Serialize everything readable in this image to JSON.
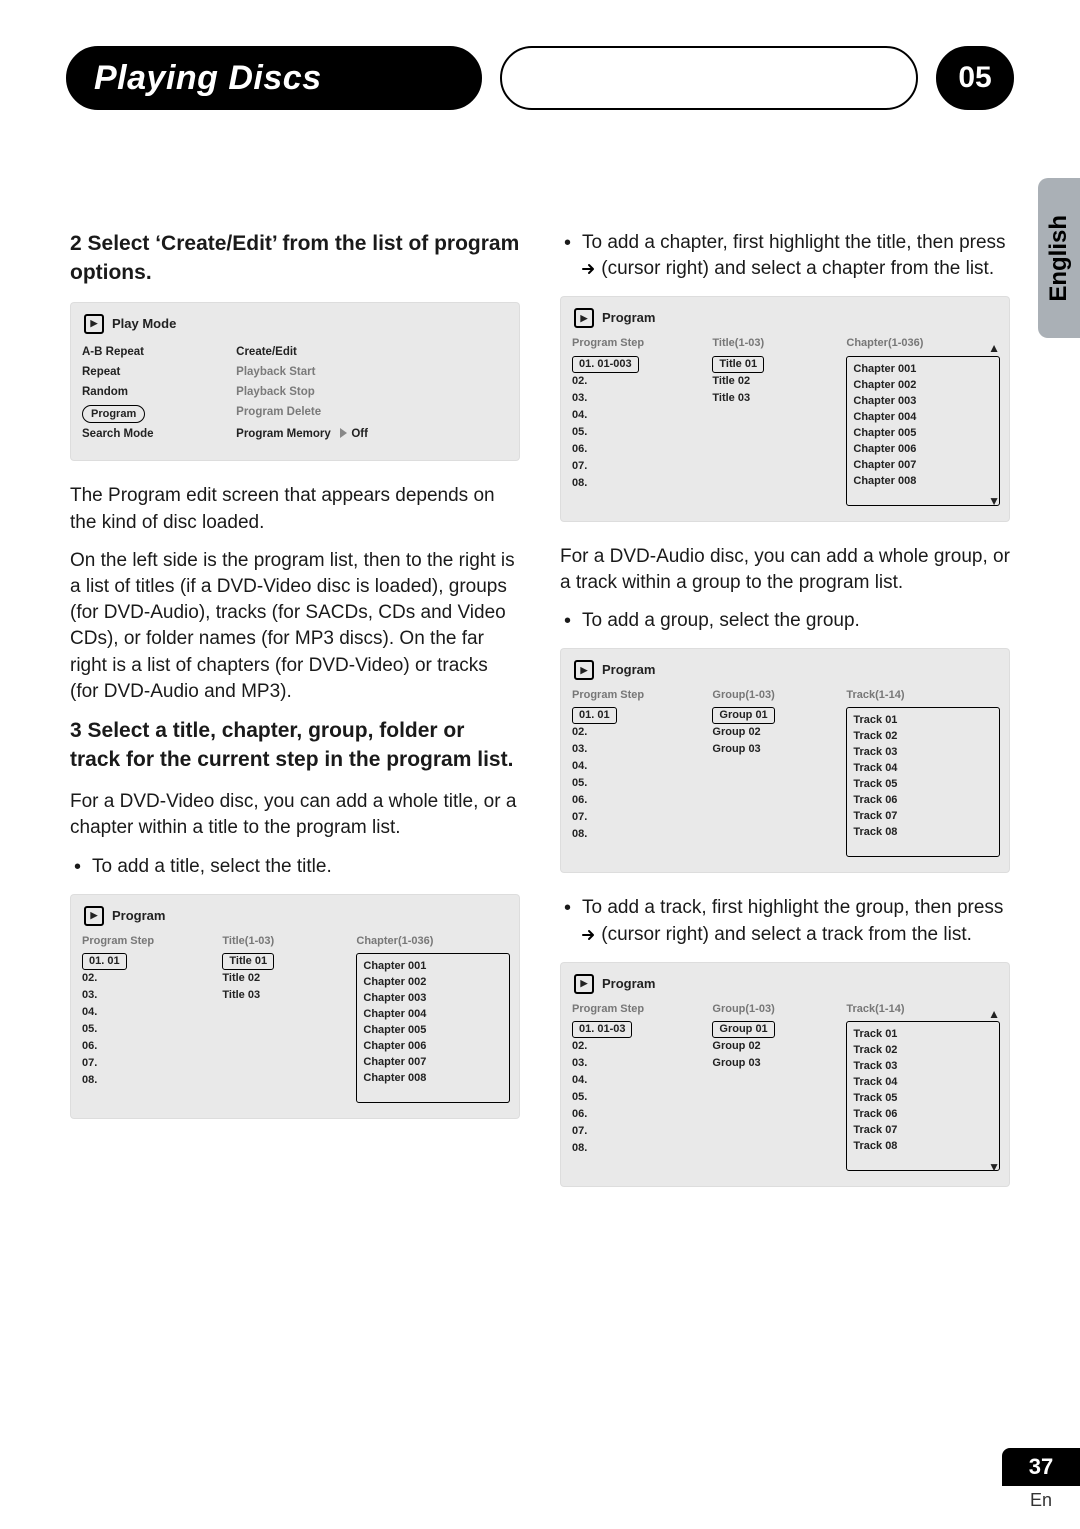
{
  "section": {
    "title": "Playing Discs",
    "number": "05"
  },
  "lang_tab": "English",
  "page_number": "37",
  "page_lang": "En",
  "left": {
    "step2": "2   Select ‘Create/Edit’ from the list of program options.",
    "p1": "The Program edit screen that appears depends on the kind of disc loaded.",
    "p2": "On the left side is the program list, then to the right is a list of titles (if a DVD-Video disc is loaded), groups (for DVD-Audio), tracks (for SACDs, CDs and Video CDs), or folder names (for MP3 discs). On the far right is a list of chapters (for DVD-Video) or tracks (for DVD-Audio and MP3).",
    "step3": "3   Select a title, chapter, group, folder or track for the current step in the program list.",
    "p3": "For a DVD-Video disc, you can add a whole title, or a chapter within a title to the program list.",
    "bullet1": "To add a title, select the title."
  },
  "right": {
    "bullet1a": "To add a chapter, first highlight the title, then press ",
    "bullet1b": " (cursor right) and select a chapter from the list.",
    "p1": "For a DVD-Audio disc, you can add a whole group, or a track within a group to the program list.",
    "bullet2": "To add a group, select the group.",
    "bullet3a": "To add a track, first highlight the group, then press ",
    "bullet3b": " (cursor right) and select a track from the list."
  },
  "osd_playmode": {
    "title": "Play Mode",
    "left_menu": [
      "A-B Repeat",
      "Repeat",
      "Random",
      "Program",
      "Search Mode"
    ],
    "selected_left": "Program",
    "right_opts": [
      {
        "label": "Create/Edit",
        "state": "active"
      },
      {
        "label": "Playback Start",
        "state": "disabled"
      },
      {
        "label": "Playback Stop",
        "state": "disabled"
      },
      {
        "label": "Program Delete",
        "state": "disabled"
      },
      {
        "label": "Program Memory",
        "state": "toggle",
        "value": "Off"
      }
    ]
  },
  "osd_prog_title": {
    "title": "Program",
    "col1": "Program Step",
    "col2": "Title(1-03)",
    "col3": "Chapter(1-036)",
    "steps": [
      "01. 01",
      "02.",
      "03.",
      "04.",
      "05.",
      "06.",
      "07.",
      "08."
    ],
    "titles": [
      "Title 01",
      "Title 02",
      "Title 03"
    ],
    "chapters": [
      "Chapter 001",
      "Chapter 002",
      "Chapter 003",
      "Chapter 004",
      "Chapter 005",
      "Chapter 006",
      "Chapter 007",
      "Chapter 008"
    ],
    "boxed_step": "01. 01",
    "boxed_title": "Title 01"
  },
  "osd_prog_chapter": {
    "title": "Program",
    "col1": "Program Step",
    "col2": "Title(1-03)",
    "col3": "Chapter(1-036)",
    "steps": [
      "01. 01-003",
      "02.",
      "03.",
      "04.",
      "05.",
      "06.",
      "07.",
      "08."
    ],
    "titles": [
      "Title 01",
      "Title 02",
      "Title 03"
    ],
    "chapters": [
      "Chapter 001",
      "Chapter 002",
      "Chapter 003",
      "Chapter 004",
      "Chapter 005",
      "Chapter 006",
      "Chapter 007",
      "Chapter 008"
    ],
    "boxed_step": "01. 01-003",
    "boxed_title": "Title 01",
    "has_scroll": true
  },
  "osd_prog_group": {
    "title": "Program",
    "col1": "Program Step",
    "col2": "Group(1-03)",
    "col3": "Track(1-14)",
    "steps": [
      "01. 01",
      "02.",
      "03.",
      "04.",
      "05.",
      "06.",
      "07.",
      "08."
    ],
    "titles": [
      "Group 01",
      "Group 02",
      "Group 03"
    ],
    "chapters": [
      "Track 01",
      "Track 02",
      "Track 03",
      "Track 04",
      "Track 05",
      "Track 06",
      "Track 07",
      "Track 08"
    ],
    "boxed_step": "01. 01",
    "boxed_title": "Group 01"
  },
  "osd_prog_track": {
    "title": "Program",
    "col1": "Program Step",
    "col2": "Group(1-03)",
    "col3": "Track(1-14)",
    "steps": [
      "01. 01-03",
      "02.",
      "03.",
      "04.",
      "05.",
      "06.",
      "07.",
      "08."
    ],
    "titles": [
      "Group 01",
      "Group 02",
      "Group 03"
    ],
    "chapters": [
      "Track 01",
      "Track 02",
      "Track 03",
      "Track 04",
      "Track 05",
      "Track 06",
      "Track 07",
      "Track 08"
    ],
    "boxed_step": "01. 01-03",
    "boxed_title": "Group 01",
    "has_scroll": true
  }
}
